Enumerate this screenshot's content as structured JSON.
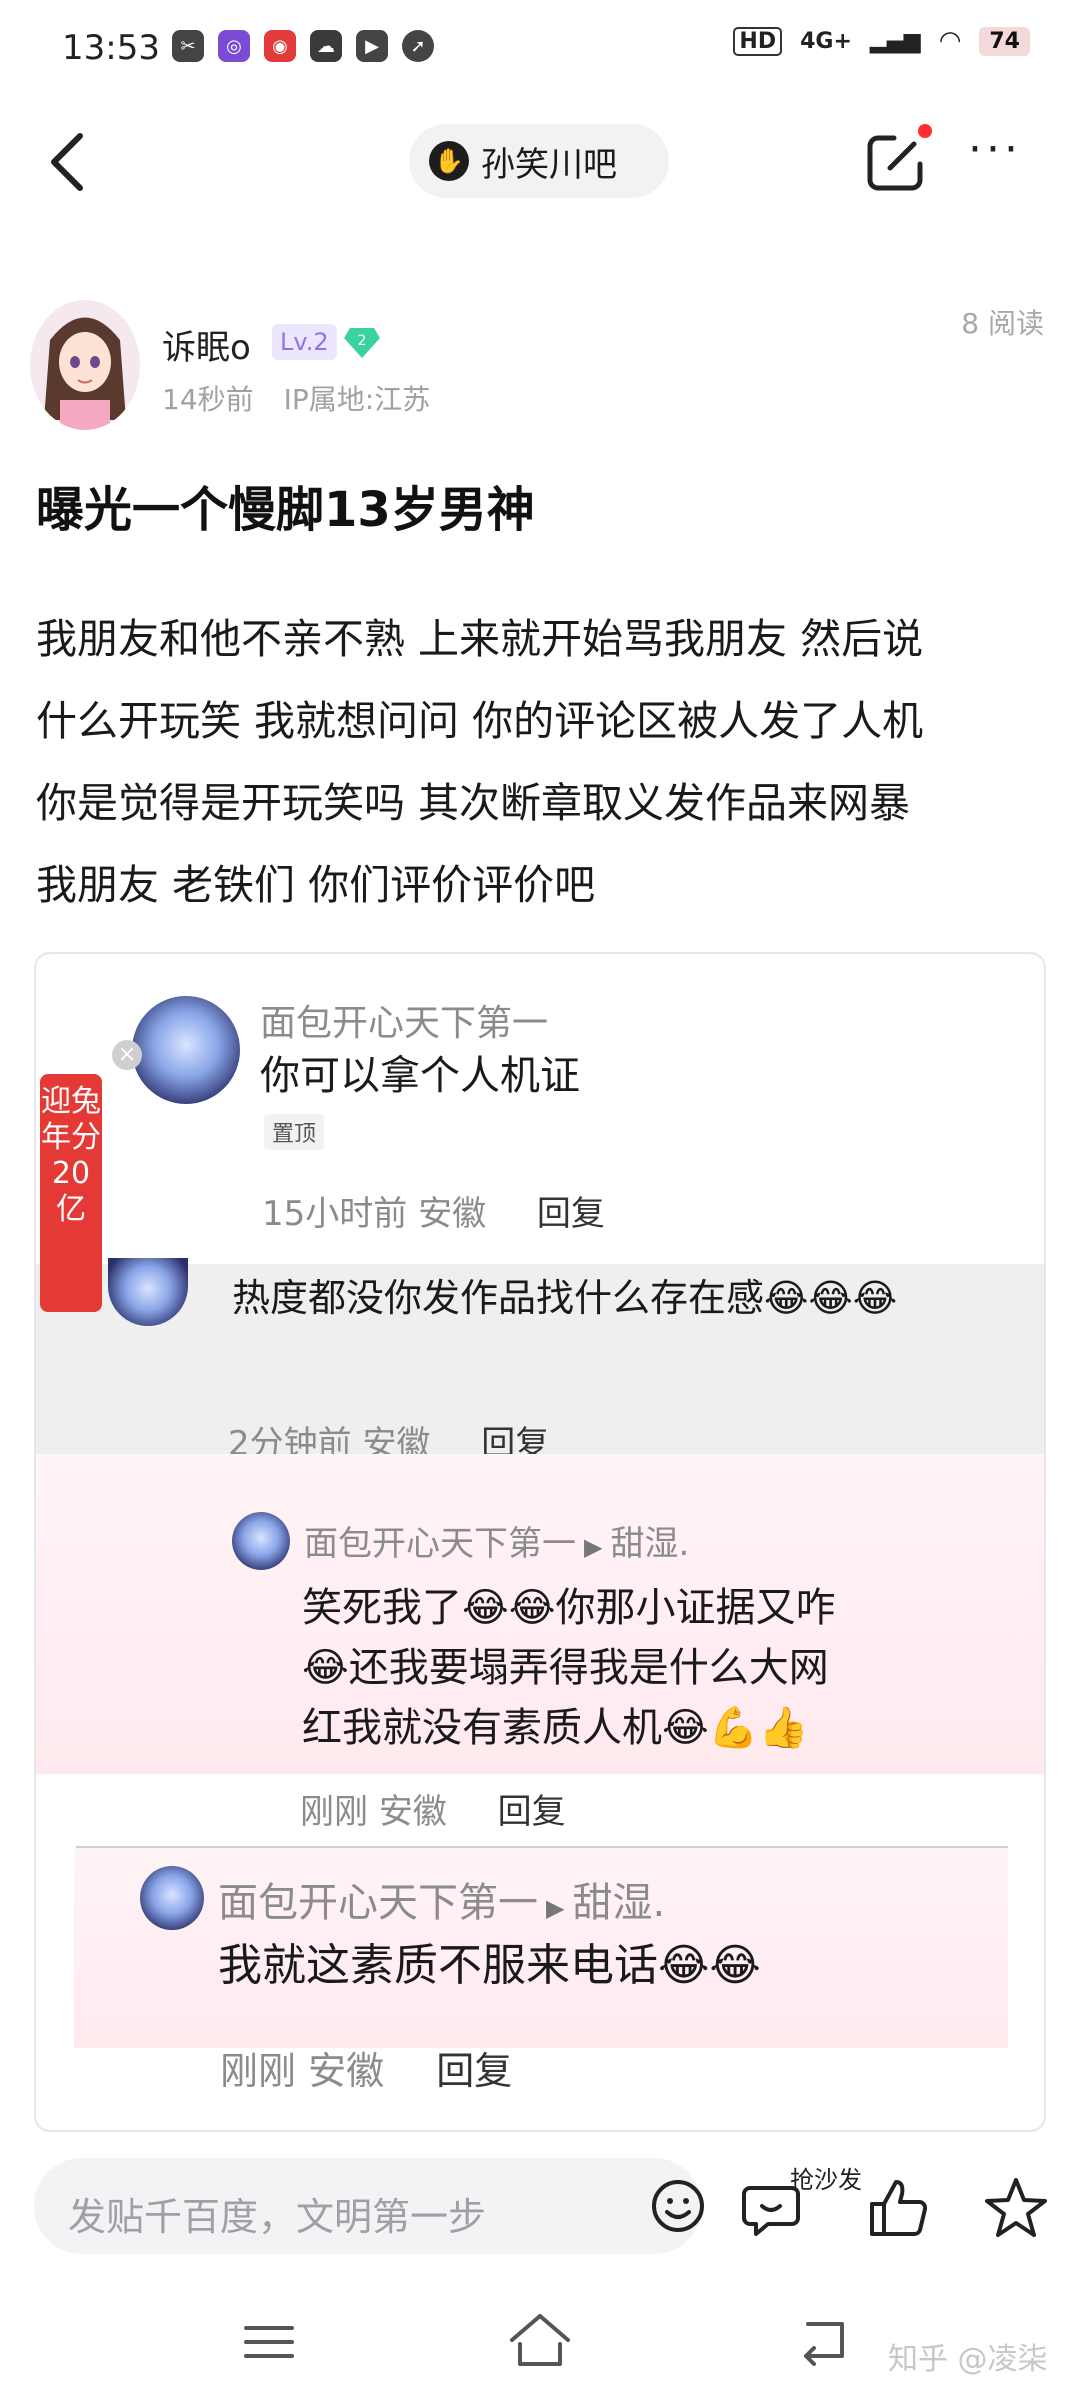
{
  "status_bar": {
    "time": "13:53",
    "network_hd": "HD",
    "network_type": "4G+",
    "battery": "74"
  },
  "nav": {
    "forum_name": "孙笑川吧"
  },
  "author": {
    "name": "诉眠o",
    "level": "Lv.2",
    "gem_level": "2",
    "time_ago": "14秒前",
    "ip": "IP属地:江苏",
    "read_count": "8 阅读"
  },
  "post": {
    "title": "曝光一个慢脚13岁男神",
    "body_lines": [
      "我朋友和他不亲不熟 上来就开始骂我朋友 然后说",
      "什么开玩笑 我就想问问 你的评论区被人发了人机",
      "你是觉得是开玩笑吗 其次断章取义发作品来网暴",
      "我朋友 老铁们 你们评价评价吧"
    ]
  },
  "embed": {
    "side_banner": "迎兔年分20亿",
    "comments": [
      {
        "name": "面包开心天下第一",
        "text": "你可以拿个人机证",
        "badge": "置顶",
        "time": "15小时前",
        "location": "安徽",
        "reply": "回复"
      },
      {
        "text": "热度都没你发作品找什么存在感😂😂😂",
        "time": "2分钟前",
        "location": "安徽",
        "reply": "回复"
      },
      {
        "name": "面包开心天下第一",
        "reply_to": "甜湿.",
        "text_lines": [
          "笑死我了😂😂你那小证据又咋",
          "😂还我要塌弄得我是什么大网",
          "红我就没有素质人机😂💪👍"
        ],
        "time": "刚刚",
        "location": "安徽",
        "reply": "回复"
      },
      {
        "name": "面包开心天下第一",
        "reply_to": "甜湿.",
        "text": "我就这素质不服来电话😂😂",
        "time": "刚刚",
        "location": "安徽",
        "reply": "回复"
      }
    ]
  },
  "bottom_bar": {
    "input_placeholder": "发贴千百度，文明第一步",
    "sofa_label": "抢沙发"
  },
  "watermark": "知乎 @凌柒",
  "colors": {
    "accent_red": "#e53935",
    "level_purple": "#8e74e8",
    "gem_green": "#3ad29f"
  }
}
